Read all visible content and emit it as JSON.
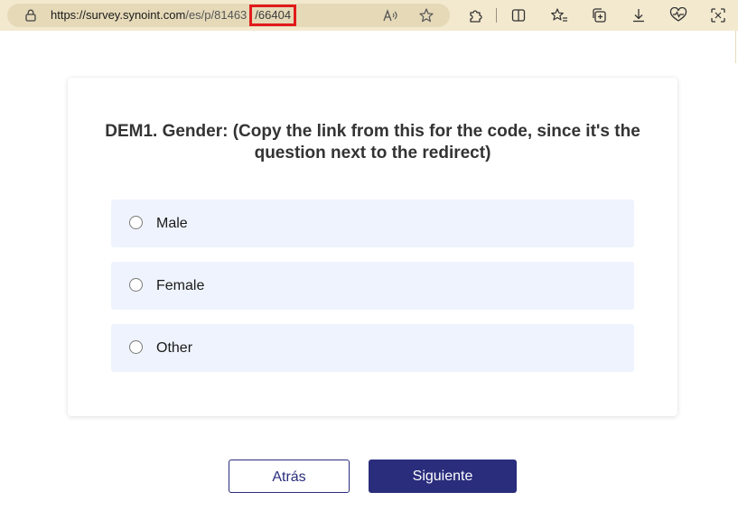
{
  "browser": {
    "url_host": "https://survey.synoint.com",
    "url_path": "/es/p/81463",
    "url_highlighted": "/66404",
    "highlight_color": "#e01b1b",
    "icons": [
      "lock-icon",
      "read-aloud-icon",
      "favorite-star-icon",
      "extensions-icon",
      "split-screen-icon",
      "favorites-icon",
      "collections-icon",
      "downloads-icon",
      "performance-icon",
      "screenshot-icon"
    ]
  },
  "survey": {
    "question": "DEM1.  Gender: (Copy the link from this for the code, since it's the question next to the redirect)",
    "options": [
      "Male",
      "Female",
      "Other"
    ]
  },
  "buttons": {
    "back": "Atrás",
    "next": "Siguiente"
  },
  "colors": {
    "accent": "#2a2d7c",
    "option_bg": "#eef3fd",
    "toolbar_bg": "#f3e9cf"
  }
}
